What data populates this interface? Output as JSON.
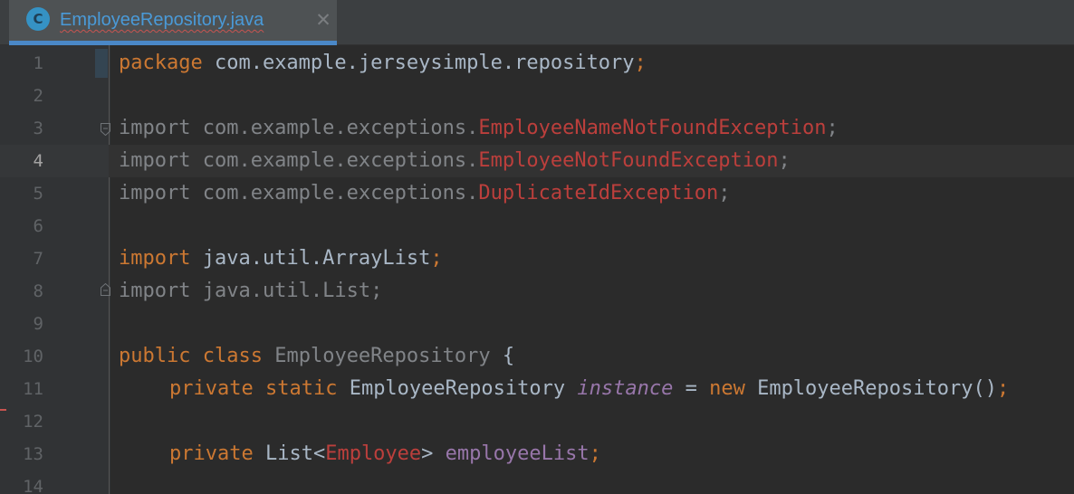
{
  "tab": {
    "icon_letter": "C",
    "title": "EmployeeRepository.java",
    "close_glyph": "✕"
  },
  "editor": {
    "current_line": 4,
    "lines": [
      {
        "num": "1"
      },
      {
        "num": "2"
      },
      {
        "num": "3"
      },
      {
        "num": "4"
      },
      {
        "num": "5"
      },
      {
        "num": "6"
      },
      {
        "num": "7"
      },
      {
        "num": "8"
      },
      {
        "num": "9"
      },
      {
        "num": "10"
      },
      {
        "num": "11"
      },
      {
        "num": "12"
      },
      {
        "num": "13"
      },
      {
        "num": "14"
      }
    ],
    "tokens": {
      "l1": [
        "package",
        " com.example.jerseysimple.repository",
        ";"
      ],
      "l3": [
        "import com.example.exceptions.",
        "EmployeeNameNotFoundException",
        ";"
      ],
      "l4": [
        "import com.example.exceptions.",
        "EmployeeNotFoundException",
        ";"
      ],
      "l5": [
        "import com.example.exceptions.",
        "DuplicateIdException",
        ";"
      ],
      "l7": [
        "import",
        " java.util.ArrayList",
        ";"
      ],
      "l8": [
        "import java.util.List;"
      ],
      "l10": [
        "public",
        " ",
        "class",
        " ",
        "EmployeeRepository",
        " {"
      ],
      "l11": [
        "private",
        " ",
        "static",
        " EmployeeRepository ",
        "instance",
        " = ",
        "new",
        " EmployeeRepository()",
        ";"
      ],
      "l13": [
        "private",
        " List<",
        "Employee",
        "> ",
        "employeeList",
        ";"
      ]
    }
  },
  "colors": {
    "keyword": "#cc7832",
    "identifier": "#a9b7c6",
    "unused_import": "#818488",
    "unresolved": "#bc3f3c",
    "field": "#9876aa",
    "tab_accent": "#4a88c7",
    "background": "#2b2b2b"
  }
}
